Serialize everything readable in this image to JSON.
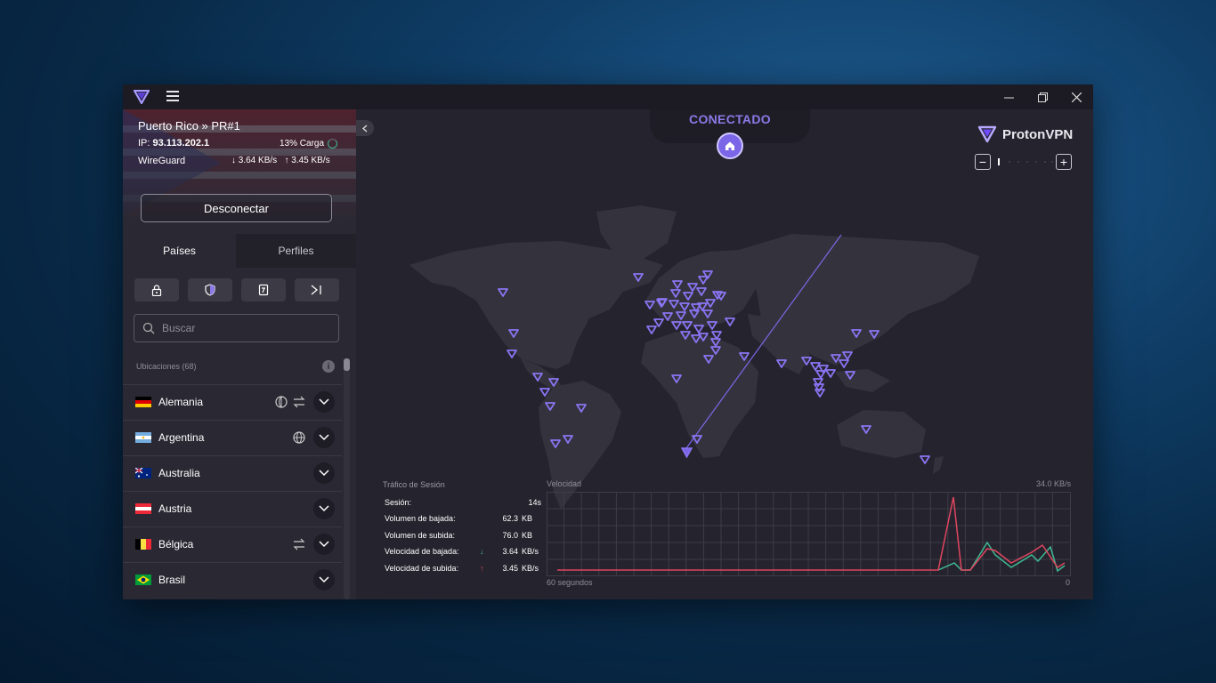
{
  "window": {
    "controls": {
      "minimize": "—",
      "maximize": "❐",
      "close": "✕"
    }
  },
  "connection": {
    "server": "Puerto Rico » PR#1",
    "ip_label": "IP:",
    "ip": "93.113.202.1",
    "load": "13% Carga",
    "protocol": "WireGuard",
    "down": "↓ 3.64 KB/s",
    "up": "↑ 3.45 KB/s",
    "disconnect_label": "Desconectar"
  },
  "tabs": {
    "countries": "Países",
    "profiles": "Perfiles"
  },
  "search": {
    "placeholder": "Buscar"
  },
  "locations_label": "Ubicaciones (68)",
  "countries": [
    {
      "name": "Alemania"
    },
    {
      "name": "Argentina"
    },
    {
      "name": "Australia"
    },
    {
      "name": "Austria"
    },
    {
      "name": "Bélgica"
    },
    {
      "name": "Brasil"
    }
  ],
  "status": "CONECTADO",
  "brand": "ProtonVPN",
  "zoom": {
    "minus": "−",
    "plus": "+"
  },
  "stats": {
    "title": "Tráfico de Sesión",
    "session_label": "Sesión:",
    "session_value": "14s",
    "down_vol_label": "Volumen de bajada:",
    "down_vol_value": "62.3",
    "down_vol_unit": "KB",
    "up_vol_label": "Volumen de subida:",
    "up_vol_value": "76.0",
    "up_vol_unit": "KB",
    "down_speed_label": "Velocidad de bajada:",
    "down_speed_value": "3.64",
    "down_speed_unit": "KB/s",
    "up_speed_label": "Velocidad de subida:",
    "up_speed_value": "3.45",
    "up_speed_unit": "KB/s"
  },
  "chart": {
    "title": "Velocidad",
    "max_label": "34.0  KB/s",
    "x_left": "60 segundos",
    "x_right": "0"
  },
  "colors": {
    "accent": "#8b79e6",
    "download_line": "#3fb893",
    "upload_line": "#e0455f"
  }
}
